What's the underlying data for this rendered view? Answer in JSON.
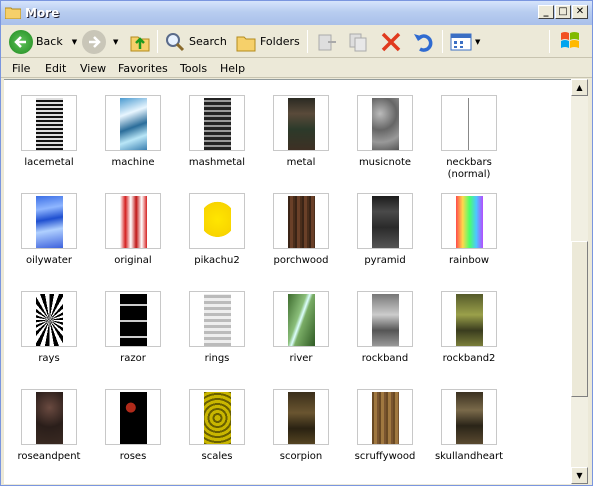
{
  "window": {
    "title": "More"
  },
  "toolbar": {
    "back": "Back",
    "search": "Search",
    "folders": "Folders"
  },
  "menu": {
    "items": [
      "File",
      "Edit",
      "View",
      "Favorites",
      "Tools",
      "Help"
    ]
  },
  "items": [
    {
      "label": "lacemetal",
      "icon": "texture-lacemetal"
    },
    {
      "label": "machine",
      "icon": "texture-machine"
    },
    {
      "label": "mashmetal",
      "icon": "texture-mashmetal"
    },
    {
      "label": "metal",
      "icon": "texture-metal"
    },
    {
      "label": "musicnote",
      "icon": "texture-musicnote"
    },
    {
      "label": "neckbars\n(normal)",
      "icon": "texture-neckbars"
    },
    {
      "label": "oilywater",
      "icon": "texture-oilywater"
    },
    {
      "label": "original",
      "icon": "texture-original"
    },
    {
      "label": "pikachu2",
      "icon": "texture-pikachu2"
    },
    {
      "label": "porchwood",
      "icon": "texture-porchwood"
    },
    {
      "label": "pyramid",
      "icon": "texture-pyramid"
    },
    {
      "label": "rainbow",
      "icon": "texture-rainbow"
    },
    {
      "label": "rays",
      "icon": "texture-rays"
    },
    {
      "label": "razor",
      "icon": "texture-razor"
    },
    {
      "label": "rings",
      "icon": "texture-rings"
    },
    {
      "label": "river",
      "icon": "texture-river"
    },
    {
      "label": "rockband",
      "icon": "texture-rockband"
    },
    {
      "label": "rockband2",
      "icon": "texture-rockband2"
    },
    {
      "label": "roseandpent",
      "icon": "texture-roseandpent"
    },
    {
      "label": "roses",
      "icon": "texture-roses"
    },
    {
      "label": "scales",
      "icon": "texture-scales"
    },
    {
      "label": "scorpion",
      "icon": "texture-scorpion"
    },
    {
      "label": "scruffywood",
      "icon": "texture-scruffywood"
    },
    {
      "label": "skullandheart",
      "icon": "texture-skullandheart"
    }
  ]
}
